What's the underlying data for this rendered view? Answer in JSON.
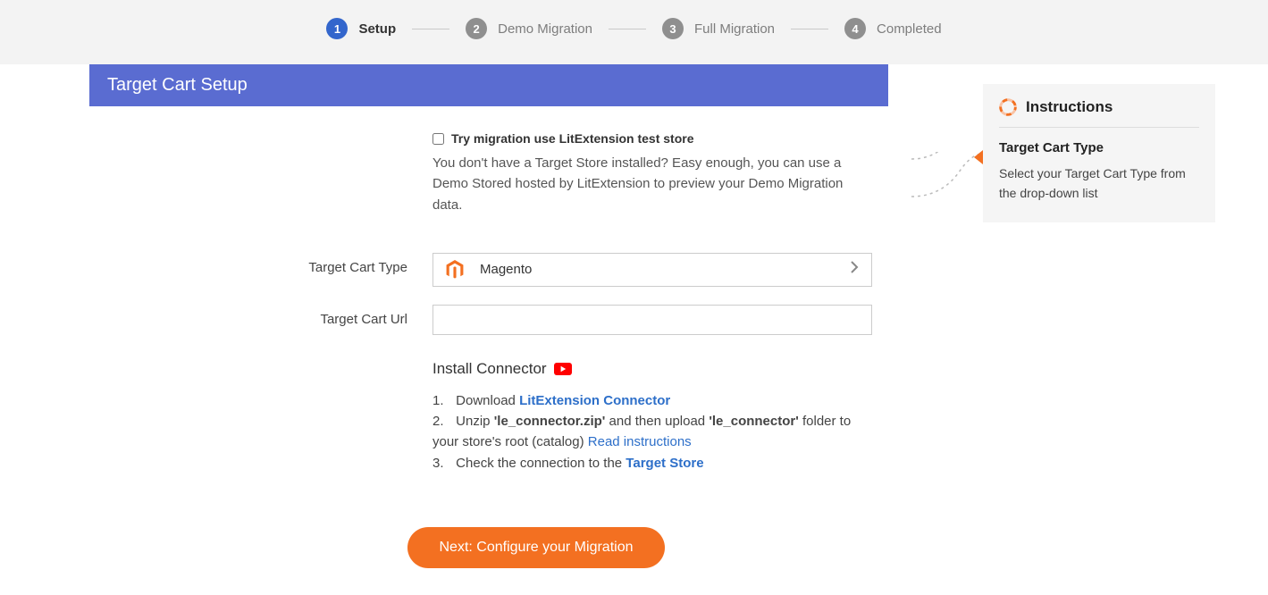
{
  "stepper": {
    "steps": [
      {
        "num": "1",
        "label": "Setup",
        "active": true
      },
      {
        "num": "2",
        "label": "Demo Migration",
        "active": false
      },
      {
        "num": "3",
        "label": "Full Migration",
        "active": false
      },
      {
        "num": "4",
        "label": "Completed",
        "active": false
      }
    ]
  },
  "panel": {
    "title": "Target Cart Setup"
  },
  "test_store": {
    "checkbox_label": "Try migration use LitExtension test store",
    "description": "You don't have a Target Store installed? Easy enough, you can use a Demo Stored hosted by LitExtension to preview your Demo Migration data."
  },
  "form": {
    "type_label": "Target Cart Type",
    "type_value": "Magento",
    "url_label": "Target Cart Url",
    "url_value": ""
  },
  "install": {
    "heading": "Install Connector",
    "items": {
      "n1": "1.",
      "t1_pre": "Download ",
      "t1_link": "LitExtension Connector",
      "n2": "2.",
      "t2_pre": "Unzip ",
      "t2_b1": "'le_connector.zip'",
      "t2_mid": " and then upload ",
      "t2_b2": "'le_connector'",
      "t2_post": " folder to your store's root (catalog) ",
      "t2_link": "Read instructions",
      "n3": "3.",
      "t3_pre": "Check the connection to the ",
      "t3_link": "Target Store"
    }
  },
  "next_button": "Next: Configure your Migration",
  "instructions": {
    "title": "Instructions",
    "subtitle": "Target Cart Type",
    "body": "Select your Target Cart Type from the drop-down list"
  }
}
